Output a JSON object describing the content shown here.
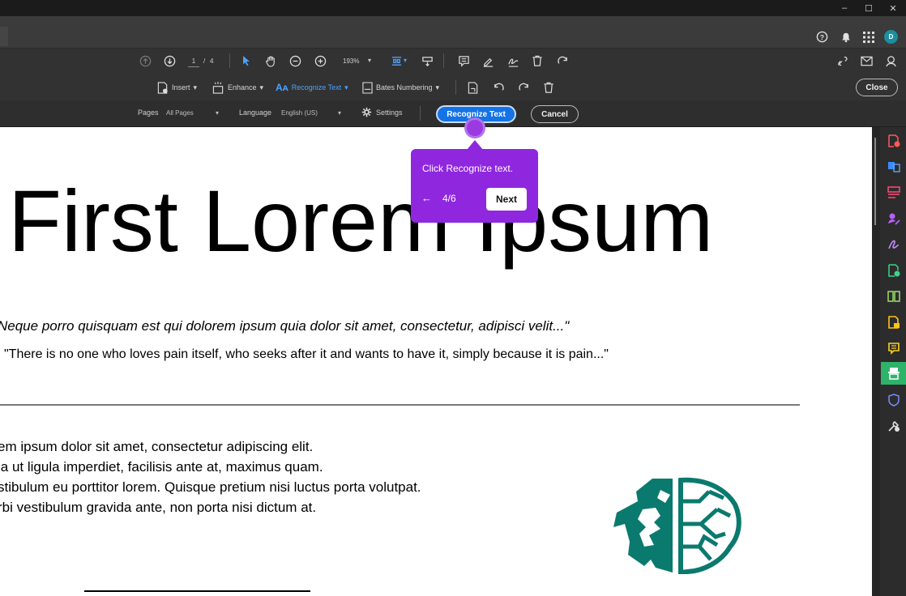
{
  "window": {
    "minimize": "–",
    "maximize": "☐",
    "close": "✕"
  },
  "appbar": {
    "avatar_initial": "D"
  },
  "nav": {
    "page_current": "1",
    "page_sep": "/",
    "page_total": "4",
    "zoom": "193%"
  },
  "tools": {
    "insert": "Insert",
    "enhance": "Enhance",
    "recognize_text": "Recognize Text",
    "bates": "Bates Numbering",
    "close": "Close"
  },
  "ocr_options": {
    "pages_label": "Pages",
    "pages_value": "All Pages",
    "language_label": "Language",
    "language_value": "English (US)",
    "settings": "Settings",
    "recognize_button": "Recognize Text",
    "cancel_button": "Cancel"
  },
  "coach": {
    "title": "Click Recognize text.",
    "back": "←",
    "step": "4/6",
    "next": "Next"
  },
  "document": {
    "heading": "First Lorem Ipsum",
    "quote_latin": "Neque porro quisquam est qui dolorem ipsum quia dolor sit amet, consectetur, adipisci velit...\"",
    "quote_english": "\"There is no one who loves pain itself, who seeks after it and wants to have it, simply because it is pain...\"",
    "paragraph": [
      "em ipsum dolor sit amet, consectetur adipiscing elit.",
      "la ut ligula imperdiet, facilisis ante at, maximus quam.",
      "stibulum eu porttitor lorem. Quisque pretium nisi luctus porta volutpat.",
      "rbi vestibulum gravida ante, non porta nisi dictum at."
    ]
  },
  "colors": {
    "accent_blue": "#1473e6",
    "coach_purple": "#8f27df",
    "logo_teal": "#0b7a6e",
    "rail_active": "#2fb36b"
  },
  "icons": [
    "help-icon",
    "bell-icon",
    "apps-icon",
    "arrow-up-icon",
    "arrow-down-icon",
    "pointer-icon",
    "hand-icon",
    "zoom-out-icon",
    "zoom-in-icon",
    "fit-icon",
    "scroll-mode-icon",
    "comment-icon",
    "highlight-icon",
    "sign-icon",
    "delete-icon",
    "rotate-icon"
  ]
}
